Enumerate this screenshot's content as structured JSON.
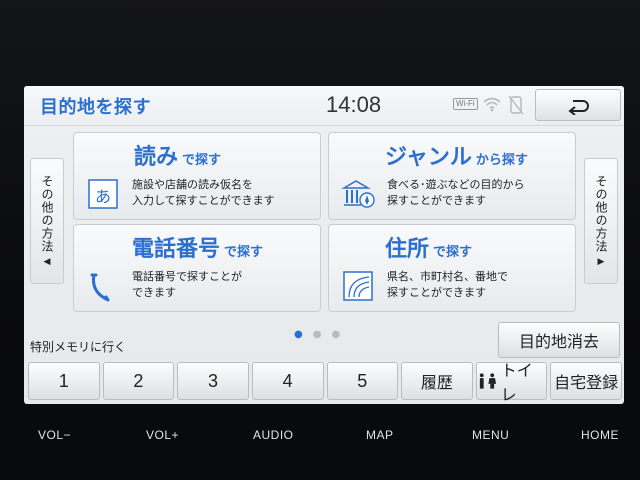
{
  "header": {
    "title": "目的地を探す",
    "time": "14:08",
    "wifi_label": "Wi-Fi",
    "wifi_icon": "wifi-signal-icon",
    "phone_icon": "phone-disconnected-icon",
    "back_icon": "return-arrow-icon"
  },
  "side": {
    "left_label": "その他の方法",
    "left_arrow": "◀",
    "right_label": "その他の方法",
    "right_arrow": "▶"
  },
  "cards": {
    "reading": {
      "title_big": "読み",
      "title_small": "で探す",
      "desc_1": "施設や店舗の読み仮名を",
      "desc_2": "入力して探すことができます",
      "icon_char": "あ"
    },
    "genre": {
      "title_big": "ジャンル",
      "title_small": "から探す",
      "desc_1": "食べる･遊ぶなどの目的から",
      "desc_2": "探すことができます"
    },
    "phone": {
      "title_big": "電話番号",
      "title_small": "で探す",
      "desc_1": "電話番号で探すことが",
      "desc_2": "できます"
    },
    "address": {
      "title_big": "住所",
      "title_small": "で探す",
      "desc_1": "県名、市町村名、番地で",
      "desc_2": "探すことができます"
    }
  },
  "memory": {
    "label": "特別メモリに行く",
    "clear_destination": "目的地消去",
    "buttons": [
      "1",
      "2",
      "3",
      "4",
      "5"
    ],
    "history": "履歴",
    "toilet": "トイレ",
    "home": "自宅登録"
  },
  "pagination": {
    "current": 1,
    "total": 3
  },
  "hardware": {
    "vol_down": "VOL−",
    "vol_up": "VOL+",
    "audio": "AUDIO",
    "map": "MAP",
    "menu": "MENU",
    "home": "HOME"
  },
  "colors": {
    "accent": "#2b6fd0",
    "bezel": "#0b0c0e",
    "screen_bg": "#eceef0"
  }
}
